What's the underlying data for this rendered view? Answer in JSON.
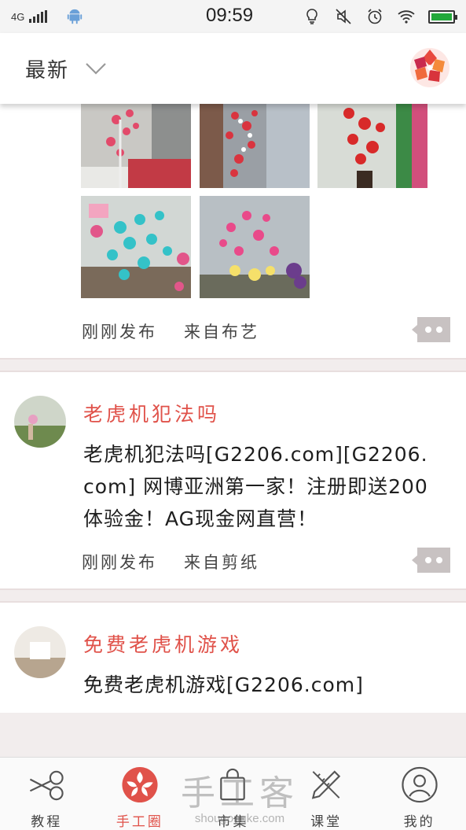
{
  "status_bar": {
    "network": "4G",
    "time": "09:59",
    "colors": {
      "battery": "#22a83a"
    }
  },
  "app_bar": {
    "filter_label": "最新"
  },
  "posts": [
    {
      "meta_time": "刚刚发布",
      "meta_source": "来自布艺"
    },
    {
      "author": "老虎机犯法吗",
      "content": "老虎机犯法吗[G2206.com][G2206.com] 网博亚洲第一家！注册即送200体验金！AG现金网直营！",
      "meta_time": "刚刚发布",
      "meta_source": "来自剪纸"
    },
    {
      "author": "免费老虎机游戏",
      "content": "免费老虎机游戏[G2206.com]"
    }
  ],
  "bottom_nav": [
    {
      "label": "教程",
      "icon": "scissors-icon"
    },
    {
      "label": "手工圈",
      "icon": "flower-logo-icon"
    },
    {
      "label": "市集",
      "icon": "shopping-bag-icon"
    },
    {
      "label": "课堂",
      "icon": "pencil-ruler-icon"
    },
    {
      "label": "我的",
      "icon": "user-icon"
    }
  ],
  "watermark": {
    "main": "手工客",
    "sub": "shougongke.com"
  },
  "colors": {
    "accent": "#e0524a",
    "background": "#f2eded"
  }
}
